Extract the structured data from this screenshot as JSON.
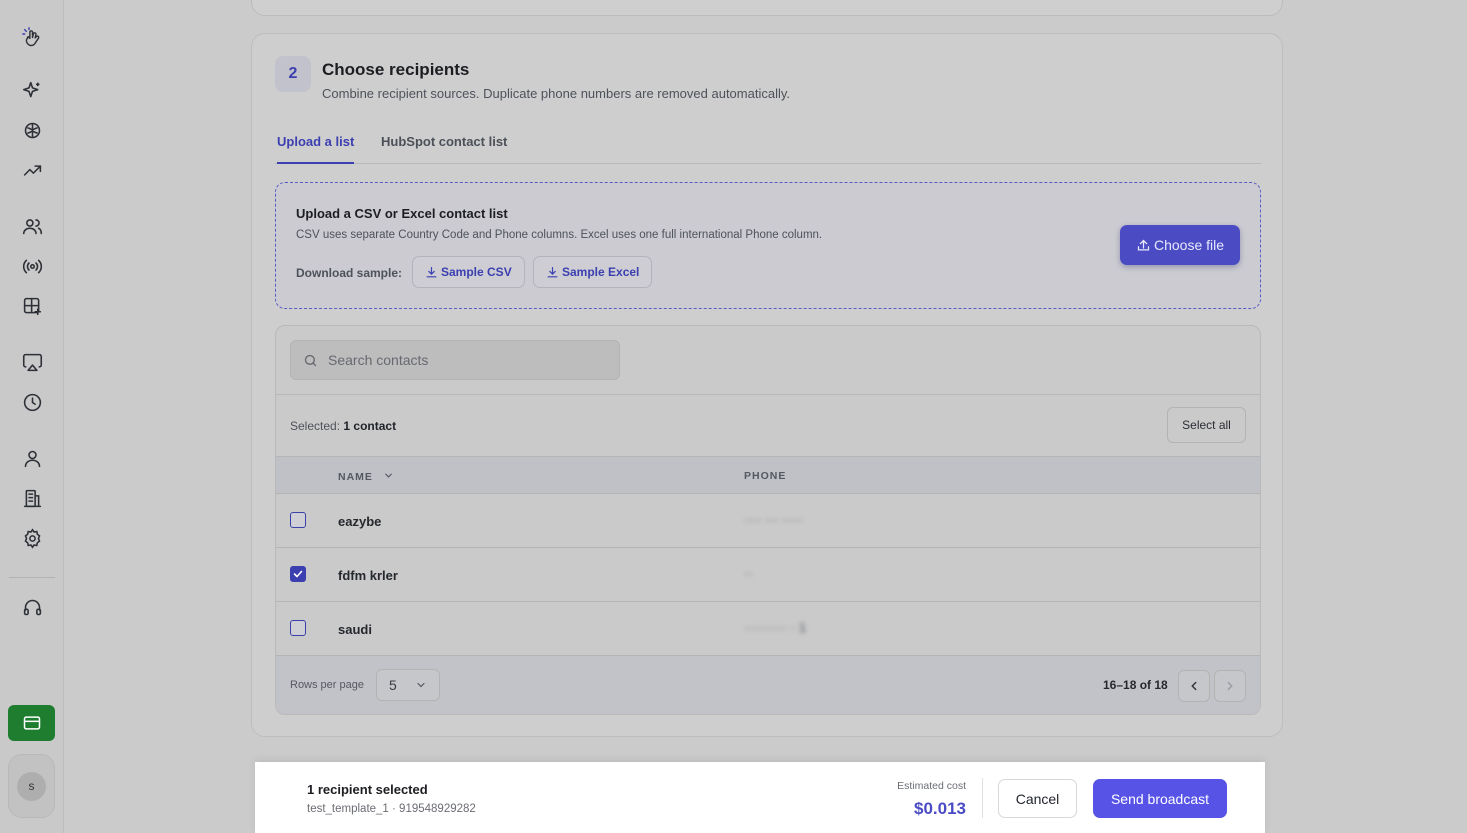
{
  "sidebar": {
    "icons": [
      "logo-icon",
      "sparkle-icon",
      "brain-icon",
      "trending-icon",
      "users-icon",
      "broadcast-icon",
      "template-add-icon",
      "cast-icon",
      "clock-icon",
      "user-icon",
      "building-icon",
      "gear-icon",
      "headset-icon"
    ],
    "avatar_initial": "s"
  },
  "step": {
    "number": "2",
    "title": "Choose recipients",
    "subtitle": "Combine recipient sources. Duplicate phone numbers are removed automatically."
  },
  "tabs": [
    {
      "label": "Upload a list",
      "active": true
    },
    {
      "label": "HubSpot contact list",
      "active": false
    }
  ],
  "upload": {
    "title": "Upload a CSV or Excel contact list",
    "description": "CSV uses separate Country Code and Phone columns. Excel uses one full international Phone column.",
    "download_label": "Download sample:",
    "sample_csv": "Sample CSV",
    "sample_excel": "Sample Excel",
    "choose_file": "Choose file"
  },
  "contacts": {
    "search_placeholder": "Search contacts",
    "selected_prefix": "Selected:",
    "selected_count": "1 contact",
    "select_all": "Select all",
    "columns": {
      "name": "NAME",
      "phone": "PHONE"
    },
    "rows": [
      {
        "name": "eazybe",
        "phone": "···· ··· ·····",
        "checked": false
      },
      {
        "name": "fdfm krler",
        "phone": "··",
        "checked": true
      },
      {
        "name": "saudi",
        "phone": "·········· · 1",
        "checked": false
      }
    ],
    "rows_per_page_label": "Rows per page",
    "rows_per_page": "5",
    "range": "16–18 of 18"
  },
  "footer": {
    "recipients": "1 recipient selected",
    "template_info": "test_template_1 · 919548929282",
    "cost_label": "Estimated cost",
    "cost_value": "$0.013",
    "cancel": "Cancel",
    "send": "Send broadcast"
  },
  "colors": {
    "accent": "#4b4cc4",
    "send_button": "#5653e6",
    "billing_button": "#1e7d2f"
  }
}
